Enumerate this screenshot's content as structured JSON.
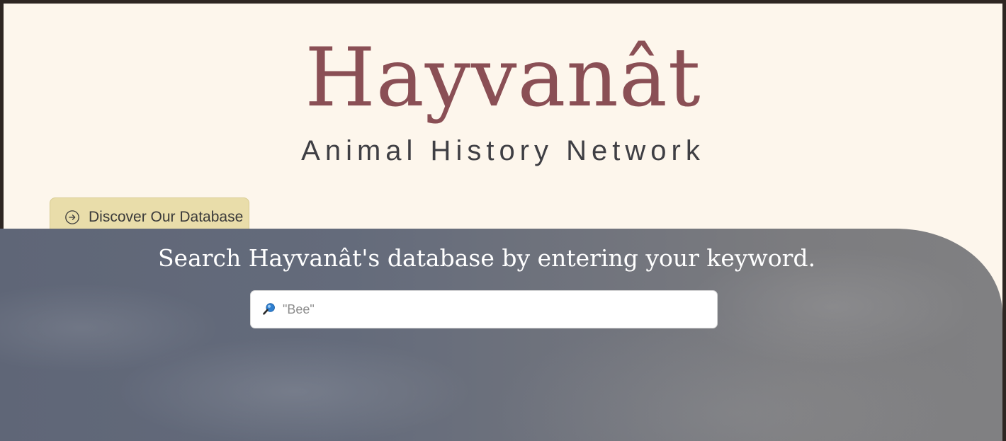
{
  "brand": {
    "title": "Hayvanât",
    "subtitle": "Animal History Network"
  },
  "discover": {
    "label": "Discover Our Database",
    "icon": "arrow-right-circle-icon"
  },
  "search": {
    "heading": "Search Hayvanât's database by entering your keyword.",
    "placeholder": "\"Bee\"",
    "value": "",
    "icon": "search-icon"
  },
  "colors": {
    "title": "#8a4f55",
    "subtitle": "#3f3f44",
    "page_background": "#fdf6ec",
    "button_background": "#e9ddaa",
    "hero_overlay": "#646b7b",
    "search_icon": "#2f7fd0"
  }
}
